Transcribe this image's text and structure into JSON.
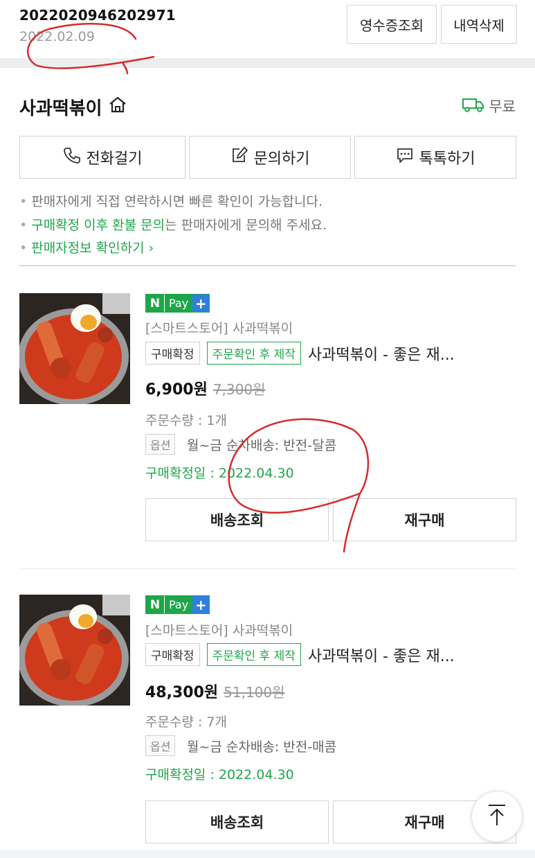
{
  "header": {
    "order_number": "2022020946202971",
    "order_date": "2022.02.09",
    "receipt_button": "영수증조회",
    "delete_button": "내역삭제"
  },
  "store": {
    "name": "사과떡볶이",
    "shipping": "무료"
  },
  "contact": {
    "call": "전화걸기",
    "inquiry": "문의하기",
    "talk": "톡톡하기"
  },
  "notices": {
    "line1": "판매자에게 직접 연락하시면 빠른 확인이 가능합니다.",
    "line2_highlight": "구매확정 이후 환불 문의",
    "line2_rest": "는 판매자에게 문의해 주세요.",
    "line3": "판매자정보 확인하기"
  },
  "items": [
    {
      "npay_label": "Pay",
      "seller": "[스마트스토어] 사과떡볶이",
      "status_badge": "구매확정",
      "made_badge": "주문확인 후 제작",
      "product_name": "사과떡볶이 - 좋은 재...",
      "price": "6,900원",
      "original_price": "7,300원",
      "quantity": "주문수량 : 1개",
      "option_tag": "옵션",
      "option": "월~금 순차배송: 반전-달콤",
      "confirm_date": "구매확정일 : 2022.04.30",
      "track_button": "배송조회",
      "rebuy_button": "재구매"
    },
    {
      "npay_label": "Pay",
      "seller": "[스마트스토어] 사과떡볶이",
      "status_badge": "구매확정",
      "made_badge": "주문확인 후 제작",
      "product_name": "사과떡볶이 - 좋은 재...",
      "price": "48,300원",
      "original_price": "51,100원",
      "quantity": "주문수량 : 7개",
      "option_tag": "옵션",
      "option": "월~금 순차배송: 반전-매콤",
      "confirm_date": "구매확정일 : 2022.04.30",
      "track_button": "배송조회",
      "rebuy_button": "재구매"
    }
  ],
  "colors": {
    "green": "#1fa64a",
    "npay_blue": "#2f7fe0",
    "annotation_red": "#d62a2a"
  },
  "icons": [
    "home-icon",
    "truck-icon",
    "phone-icon",
    "edit-icon",
    "chat-icon",
    "arrow-up-icon"
  ]
}
